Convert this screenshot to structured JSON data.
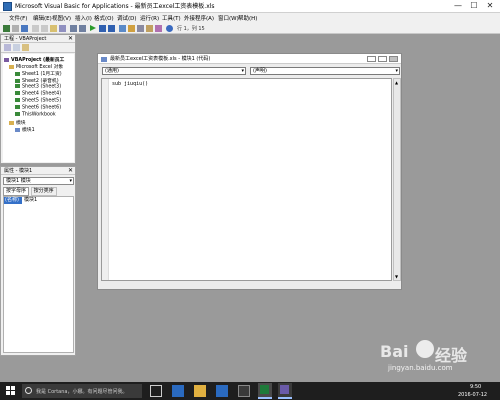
{
  "window": {
    "title": "Microsoft Visual Basic for Applications - 最新员工excel工资表模板.xls",
    "min": "—",
    "max": "☐",
    "close": "✕"
  },
  "menu": [
    "文件(F)",
    "编辑(E)",
    "视图(V)",
    "插入(I)",
    "格式(O)",
    "调试(D)",
    "运行(R)",
    "工具(T)",
    "外接程序(A)",
    "窗口(W)",
    "帮助(H)"
  ],
  "toolbar": {
    "position": "行 1，列 15"
  },
  "project": {
    "title": "工程 - VBAProject",
    "nodes": [
      "VBAProject (最新员工",
      "Microsoft Excel 对象",
      "Sheet1 (1月工资)",
      "Sheet2 (录音机)",
      "Sheet3 (Sheet3)",
      "Sheet4 (Sheet4)",
      "Sheet5 (Sheet5)",
      "Sheet6 (Sheet6)",
      "ThisWorkbook",
      "模块",
      "模块1"
    ]
  },
  "properties": {
    "title": "属性 - 模块1",
    "object": "模块1 模块",
    "tabs": [
      "按字母序",
      "按分类序"
    ],
    "row_name": "(名称)",
    "row_value": "模块1"
  },
  "code": {
    "title": "最新员工excel工资表模板.xls - 模块1 (代码)",
    "combo_left": "(通用)",
    "combo_right": "(声明)",
    "line1": "sub jiuqiu()"
  },
  "taskbar": {
    "search": "我是 Cortana，小娜。有问题尽管问我。",
    "time": "9:50",
    "date": "2016-07-12"
  },
  "watermark": "jingyan.baidu.com"
}
